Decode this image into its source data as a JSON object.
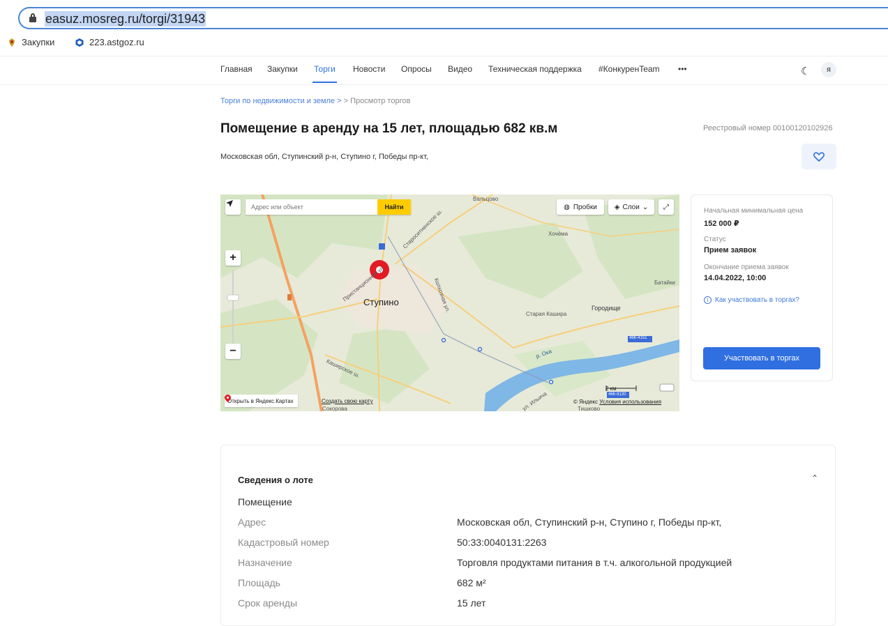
{
  "browser": {
    "url": "easuz.mosreg.ru/torgi/31943"
  },
  "bookmarks": [
    {
      "label": "Закупки",
      "icon": "emblem-icon"
    },
    {
      "label": "223.astgoz.ru",
      "icon": "hex-logo-icon"
    }
  ],
  "nav": {
    "items": [
      "Главная",
      "Закупки",
      "Торги",
      "Новости",
      "Опросы",
      "Видео",
      "Техническая поддержка",
      "#КонкуренTeam",
      "•••"
    ],
    "active": "Торги",
    "accent": "#2f6fe0"
  },
  "breadcrumb": {
    "link": "Торги по недвижимости и земле",
    "sep": ">",
    "sep2": ">",
    "current": "Просмотр торгов"
  },
  "page": {
    "title": "Помещение в аренду на 15 лет, площадью 682 кв.м",
    "registry": "Реестровый номер 00100120102926",
    "address": "Московская обл, Ступинский р-н, Ступино г, Победы пр-кт,"
  },
  "map": {
    "search_placeholder": "Адрес или объект",
    "find": "Найти",
    "traffic": "Пробки",
    "layers": "Слои",
    "city": "Ступино",
    "places": [
      "Вальцово",
      "Хочёма",
      "Батайки",
      "Городище",
      "Старая Кашира",
      "Сокорова",
      "Тишково"
    ],
    "river": "р. Ока",
    "roads": [
      "Староситненское ш.",
      "Пристанционная ул.",
      "Колхозная ул.",
      "Каширское ш.",
      "ул. Ильича"
    ],
    "road_badges": [
      "46К-4151",
      "46К-9120"
    ],
    "scale": "2 км",
    "open_link": "Открыть в Яндекс.Картах",
    "create_link": "Создать свою карту",
    "copyright": "© Яндекс",
    "terms": "Условия использования"
  },
  "info_card": {
    "price_label": "Начальная минимальная цена",
    "price": "152 000 ₽",
    "status_label": "Статус",
    "status": "Прием заявок",
    "end_label": "Окончание приема заявок",
    "end": "14.04.2022, 10:00",
    "how_link": "Как участвовать в торгах?",
    "participate": "Участвовать в торгах"
  },
  "lot": {
    "heading": "Сведения о лоте",
    "type": "Помещение",
    "rows": [
      {
        "k": "Адрес",
        "v": "Московская обл, Ступинский р-н, Ступино г, Победы пр-кт,"
      },
      {
        "k": "Кадастровый номер",
        "v": "50:33:0040131:2263"
      },
      {
        "k": "Назначение",
        "v": "Торговля продуктами питания в т.ч. алкогольной продукцией"
      },
      {
        "k": "Площадь",
        "v": "682 м²"
      },
      {
        "k": "Срок аренды",
        "v": "15 лет"
      }
    ]
  }
}
